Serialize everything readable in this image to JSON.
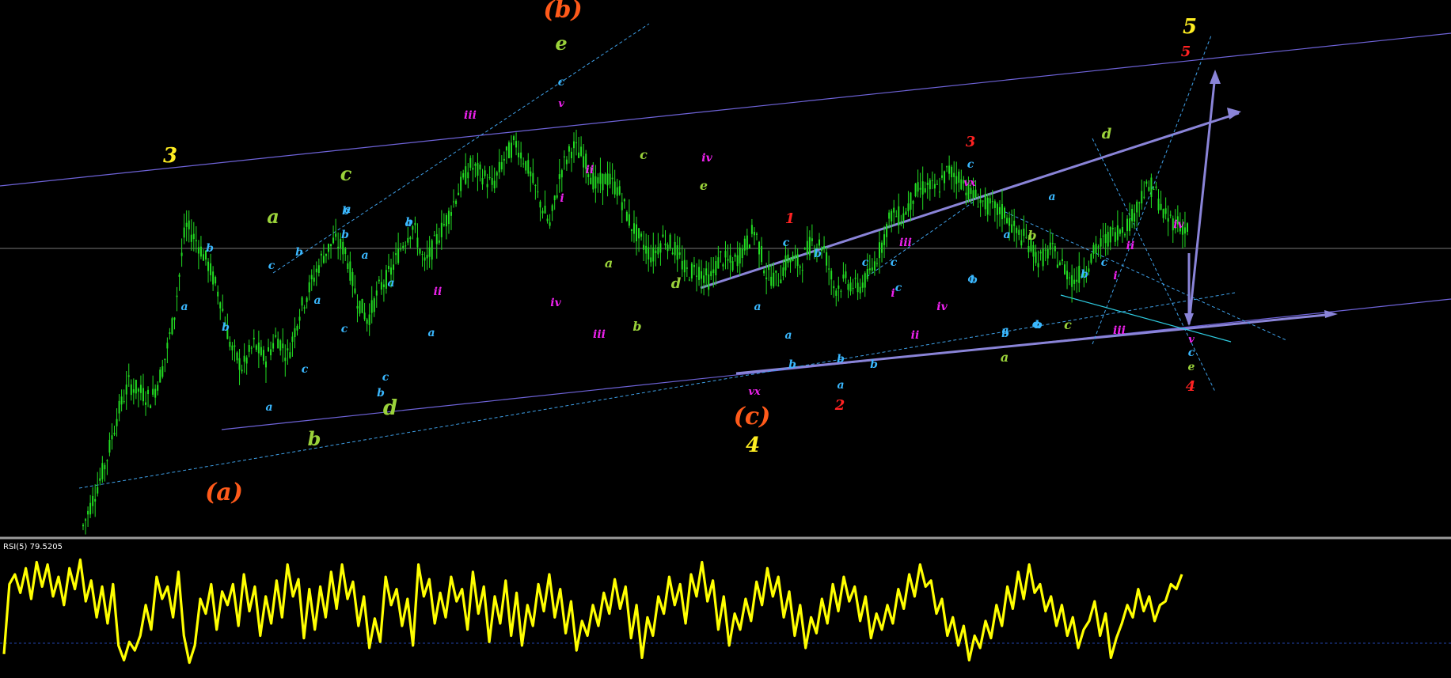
{
  "colors": {
    "background": "#000000",
    "candle": "#22dd22",
    "rsi_line": "#ffff00",
    "channel_line": "#6e63d8",
    "triangle_line": "#8a84d8",
    "dotted_line": "#3fa0e8",
    "price_hline": "#777777",
    "separator": "#9a9a9a",
    "cyan_line": "#2ecbe0",
    "labels": {
      "yellow": "#ffee22",
      "orange": "#ff5a1a",
      "green": "#9ad23a",
      "cyan": "#3ab8ff",
      "magenta": "#ee22ee",
      "red": "#ff2222"
    }
  },
  "rsi_panel": {
    "caption": "RSI(5) 79.5205"
  },
  "chart_data": [
    {
      "type": "candlestick",
      "title": "",
      "grid": false,
      "ylim": [
        0,
        100
      ],
      "price_path": [
        [
          0,
          2
        ],
        [
          2,
          18
        ],
        [
          3,
          30
        ],
        [
          4,
          38
        ],
        [
          5,
          36
        ],
        [
          6,
          34
        ],
        [
          7,
          42
        ],
        [
          8,
          55
        ],
        [
          9,
          78
        ],
        [
          10,
          74
        ],
        [
          11,
          68
        ],
        [
          12,
          60
        ],
        [
          13,
          47
        ],
        [
          14,
          42
        ],
        [
          15,
          48
        ],
        [
          16,
          44
        ],
        [
          17,
          50
        ],
        [
          18,
          45
        ],
        [
          19,
          56
        ],
        [
          20,
          63
        ],
        [
          21,
          70
        ],
        [
          22,
          74
        ],
        [
          23,
          72
        ],
        [
          24,
          60
        ],
        [
          25,
          54
        ],
        [
          26,
          62
        ],
        [
          27,
          66
        ],
        [
          28,
          73
        ],
        [
          29,
          78
        ],
        [
          30,
          68
        ],
        [
          31,
          74
        ],
        [
          32,
          80
        ],
        [
          33,
          87
        ],
        [
          34,
          93
        ],
        [
          35,
          91
        ],
        [
          36,
          88
        ],
        [
          37,
          95
        ],
        [
          38,
          99
        ],
        [
          39,
          93
        ],
        [
          40,
          85
        ],
        [
          41,
          78
        ],
        [
          42,
          92
        ],
        [
          43,
          98
        ],
        [
          44,
          95
        ],
        [
          45,
          88
        ],
        [
          46,
          90
        ],
        [
          47,
          87
        ],
        [
          48,
          79
        ],
        [
          49,
          74
        ],
        [
          50,
          70
        ],
        [
          51,
          75
        ],
        [
          52,
          72
        ],
        [
          53,
          66
        ],
        [
          54,
          67
        ],
        [
          55,
          64
        ],
        [
          56,
          70
        ],
        [
          57,
          68
        ],
        [
          58,
          72
        ],
        [
          59,
          77
        ],
        [
          60,
          66
        ],
        [
          61,
          64
        ],
        [
          62,
          70
        ],
        [
          63,
          68
        ],
        [
          64,
          74
        ],
        [
          65,
          73
        ],
        [
          66,
          62
        ],
        [
          67,
          64
        ],
        [
          68,
          62
        ],
        [
          69,
          65
        ],
        [
          70,
          72
        ],
        [
          71,
          81
        ],
        [
          72,
          80
        ],
        [
          73,
          86
        ],
        [
          74,
          88
        ],
        [
          75,
          87
        ],
        [
          76,
          92
        ],
        [
          77,
          90
        ],
        [
          78,
          86
        ],
        [
          79,
          84
        ],
        [
          80,
          82
        ],
        [
          81,
          81
        ],
        [
          82,
          76
        ],
        [
          83,
          74
        ],
        [
          84,
          69
        ],
        [
          85,
          72
        ],
        [
          86,
          68
        ],
        [
          87,
          64
        ],
        [
          88,
          67
        ],
        [
          89,
          72
        ],
        [
          90,
          75
        ],
        [
          91,
          77
        ],
        [
          92,
          79
        ],
        [
          93,
          86
        ],
        [
          94,
          88
        ],
        [
          95,
          80
        ],
        [
          96,
          79
        ],
        [
          97,
          77
        ]
      ],
      "series": [
        {
          "values": [
            0,
            0,
            0,
            0,
            0,
            0,
            0,
            0,
            0,
            0
          ]
        }
      ],
      "ylabel": "",
      "xlabel": ""
    },
    {
      "type": "line",
      "title": "RSI(5) 79.5205",
      "ylim": [
        0,
        100
      ],
      "series": [
        {
          "values": [
            15,
            72,
            80,
            65,
            85,
            60,
            90,
            70,
            88,
            62,
            78,
            55,
            85,
            68,
            92,
            58,
            75,
            45,
            70,
            40,
            72,
            22,
            10,
            25,
            18,
            30,
            55,
            35,
            78,
            60,
            70,
            45,
            82,
            30,
            8,
            22,
            60,
            48,
            72,
            35,
            66,
            55,
            72,
            38,
            80,
            50,
            70,
            30,
            62,
            40,
            75,
            45,
            88,
            62,
            76,
            28,
            68,
            35,
            70,
            45,
            82,
            52,
            88,
            60,
            74,
            38,
            62,
            20,
            44,
            25,
            78,
            55,
            68,
            38,
            60,
            22,
            88,
            62,
            76,
            40,
            65,
            45,
            78,
            58,
            68,
            35,
            82,
            48,
            70,
            25,
            62,
            40,
            75,
            30,
            65,
            22,
            55,
            38,
            72,
            50,
            80,
            45,
            68,
            32,
            58,
            18,
            42,
            30,
            55,
            38,
            65,
            48,
            76,
            52,
            70,
            28,
            55,
            12,
            45,
            30,
            62,
            48,
            78,
            55,
            72,
            40,
            80,
            62,
            90,
            58,
            75,
            35,
            62,
            22,
            48,
            35,
            60,
            42,
            74,
            55,
            85,
            62,
            78,
            45,
            66,
            30,
            55,
            20,
            45,
            32,
            60,
            40,
            72,
            50,
            78,
            58,
            70,
            42,
            62,
            28,
            48,
            35,
            55,
            40,
            68,
            52,
            80,
            62,
            88,
            70,
            75,
            48,
            60,
            30,
            45,
            22,
            38,
            10,
            30,
            20,
            42,
            28,
            55,
            38,
            70,
            52,
            82,
            60,
            88,
            65,
            72,
            50,
            62,
            38,
            55,
            30,
            45,
            20,
            35,
            42,
            58,
            30,
            48,
            12,
            28,
            40,
            55,
            45,
            68,
            50,
            62,
            42,
            55,
            58,
            72,
            68,
            80
          ]
        }
      ]
    }
  ],
  "wave_labels": [
    {
      "text": "3",
      "color": "yellow",
      "size": 26
    },
    {
      "text": "(a)",
      "color": "orange",
      "size": 30
    },
    {
      "text": "a",
      "color": "green",
      "size": 24
    },
    {
      "text": "b",
      "color": "green",
      "size": 24
    },
    {
      "text": "c",
      "color": "green",
      "size": 24
    },
    {
      "text": "d",
      "color": "green",
      "size": 26
    },
    {
      "text": "e",
      "color": "green",
      "size": 24
    },
    {
      "text": "(b)",
      "color": "orange",
      "size": 30
    },
    {
      "text": "iii",
      "color": "magenta",
      "size": 14
    },
    {
      "text": "v",
      "color": "magenta",
      "size": 13
    },
    {
      "text": "c",
      "color": "cyan",
      "size": 14
    },
    {
      "text": "ii",
      "color": "magenta",
      "size": 14
    },
    {
      "text": "i",
      "color": "magenta",
      "size": 14
    },
    {
      "text": "ii",
      "color": "magenta",
      "size": 14
    },
    {
      "text": "iv",
      "color": "magenta",
      "size": 14
    },
    {
      "text": "iii",
      "color": "magenta",
      "size": 14
    },
    {
      "text": "c",
      "color": "green",
      "size": 16
    },
    {
      "text": "e",
      "color": "green",
      "size": 16
    },
    {
      "text": "iv",
      "color": "magenta",
      "size": 14
    },
    {
      "text": "a",
      "color": "green",
      "size": 16
    },
    {
      "text": "b",
      "color": "green",
      "size": 16
    },
    {
      "text": "d",
      "color": "green",
      "size": 18
    },
    {
      "text": "1",
      "color": "red",
      "size": 18
    },
    {
      "text": "vx",
      "color": "magenta",
      "size": 13
    },
    {
      "text": "(c)",
      "color": "orange",
      "size": 30
    },
    {
      "text": "4",
      "color": "yellow",
      "size": 26
    },
    {
      "text": "2",
      "color": "red",
      "size": 18
    },
    {
      "text": "3",
      "color": "red",
      "size": 18
    },
    {
      "text": "vx",
      "color": "magenta",
      "size": 13
    },
    {
      "text": "c",
      "color": "cyan",
      "size": 14
    },
    {
      "text": "iii",
      "color": "magenta",
      "size": 14
    },
    {
      "text": "i",
      "color": "magenta",
      "size": 14
    },
    {
      "text": "iv",
      "color": "magenta",
      "size": 14
    },
    {
      "text": "ii",
      "color": "magenta",
      "size": 14
    },
    {
      "text": "b",
      "color": "green",
      "size": 16
    },
    {
      "text": "a",
      "color": "green",
      "size": 16
    },
    {
      "text": "c",
      "color": "green",
      "size": 16
    },
    {
      "text": "d",
      "color": "green",
      "size": 18
    },
    {
      "text": "iii",
      "color": "magenta",
      "size": 14
    },
    {
      "text": "ii",
      "color": "magenta",
      "size": 14
    },
    {
      "text": "i",
      "color": "magenta",
      "size": 14
    },
    {
      "text": "iv",
      "color": "magenta",
      "size": 14
    },
    {
      "text": "5",
      "color": "yellow",
      "size": 26
    },
    {
      "text": "5",
      "color": "red",
      "size": 18
    },
    {
      "text": "v",
      "color": "magenta",
      "size": 13
    },
    {
      "text": "c",
      "color": "cyan",
      "size": 14
    },
    {
      "text": "e",
      "color": "green",
      "size": 14
    },
    {
      "text": "4",
      "color": "red",
      "size": 18
    },
    {
      "text": "b",
      "color": "cyan",
      "size": 14
    },
    {
      "text": "a",
      "color": "cyan",
      "size": 14
    },
    {
      "text": "b",
      "color": "cyan",
      "size": 14
    },
    {
      "text": "a",
      "color": "cyan",
      "size": 14
    },
    {
      "text": "c",
      "color": "cyan",
      "size": 14
    },
    {
      "text": "b",
      "color": "cyan",
      "size": 14
    },
    {
      "text": "a",
      "color": "cyan",
      "size": 14
    },
    {
      "text": "c",
      "color": "cyan",
      "size": 14
    },
    {
      "text": "a",
      "color": "cyan",
      "size": 14
    },
    {
      "text": "b",
      "color": "cyan",
      "size": 14
    },
    {
      "text": "a",
      "color": "cyan",
      "size": 14
    },
    {
      "text": "b",
      "color": "cyan",
      "size": 14
    },
    {
      "text": "c",
      "color": "cyan",
      "size": 14
    },
    {
      "text": "a",
      "color": "cyan",
      "size": 14
    },
    {
      "text": "b",
      "color": "cyan",
      "size": 14
    },
    {
      "text": "a",
      "color": "cyan",
      "size": 14
    },
    {
      "text": "a",
      "color": "cyan",
      "size": 14
    },
    {
      "text": "c",
      "color": "cyan",
      "size": 14
    },
    {
      "text": "b",
      "color": "cyan",
      "size": 14
    },
    {
      "text": "c",
      "color": "cyan",
      "size": 14
    },
    {
      "text": "b",
      "color": "cyan",
      "size": 14
    },
    {
      "text": "a",
      "color": "cyan",
      "size": 14
    },
    {
      "text": "a",
      "color": "cyan",
      "size": 14
    },
    {
      "text": "b",
      "color": "cyan",
      "size": 14
    },
    {
      "text": "c",
      "color": "cyan",
      "size": 14
    },
    {
      "text": "b",
      "color": "cyan",
      "size": 14
    },
    {
      "text": "c",
      "color": "cyan",
      "size": 14
    },
    {
      "text": "a",
      "color": "cyan",
      "size": 14
    },
    {
      "text": "b",
      "color": "cyan",
      "size": 14
    },
    {
      "text": "c",
      "color": "cyan",
      "size": 14
    },
    {
      "text": "a",
      "color": "cyan",
      "size": 14
    },
    {
      "text": "b",
      "color": "cyan",
      "size": 14
    },
    {
      "text": "a",
      "color": "cyan",
      "size": 14
    },
    {
      "text": "b",
      "color": "cyan",
      "size": 14
    },
    {
      "text": "a",
      "color": "cyan",
      "size": 14
    },
    {
      "text": "b",
      "color": "cyan",
      "size": 14
    },
    {
      "text": "c",
      "color": "cyan",
      "size": 14
    },
    {
      "text": "a",
      "color": "cyan",
      "size": 14
    },
    {
      "text": "c",
      "color": "cyan",
      "size": 14
    },
    {
      "text": "c",
      "color": "cyan",
      "size": 14
    },
    {
      "text": "c",
      "color": "cyan",
      "size": 14
    },
    {
      "text": "a",
      "color": "cyan",
      "size": 14
    },
    {
      "text": "b",
      "color": "cyan",
      "size": 14
    },
    {
      "text": "c",
      "color": "cyan",
      "size": 14
    }
  ]
}
